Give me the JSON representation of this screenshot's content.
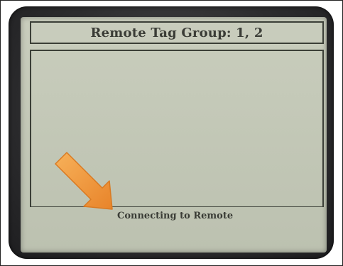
{
  "screen": {
    "title": "Remote Tag Group: 1, 2",
    "status": "Connecting to Remote"
  },
  "annotation": {
    "icon": "orange-arrow-icon",
    "color": "#f39a3c"
  },
  "colors": {
    "lcd_background": "#c5c9b9",
    "lcd_text": "#3a3c36",
    "bezel": "#2c2c2e"
  }
}
